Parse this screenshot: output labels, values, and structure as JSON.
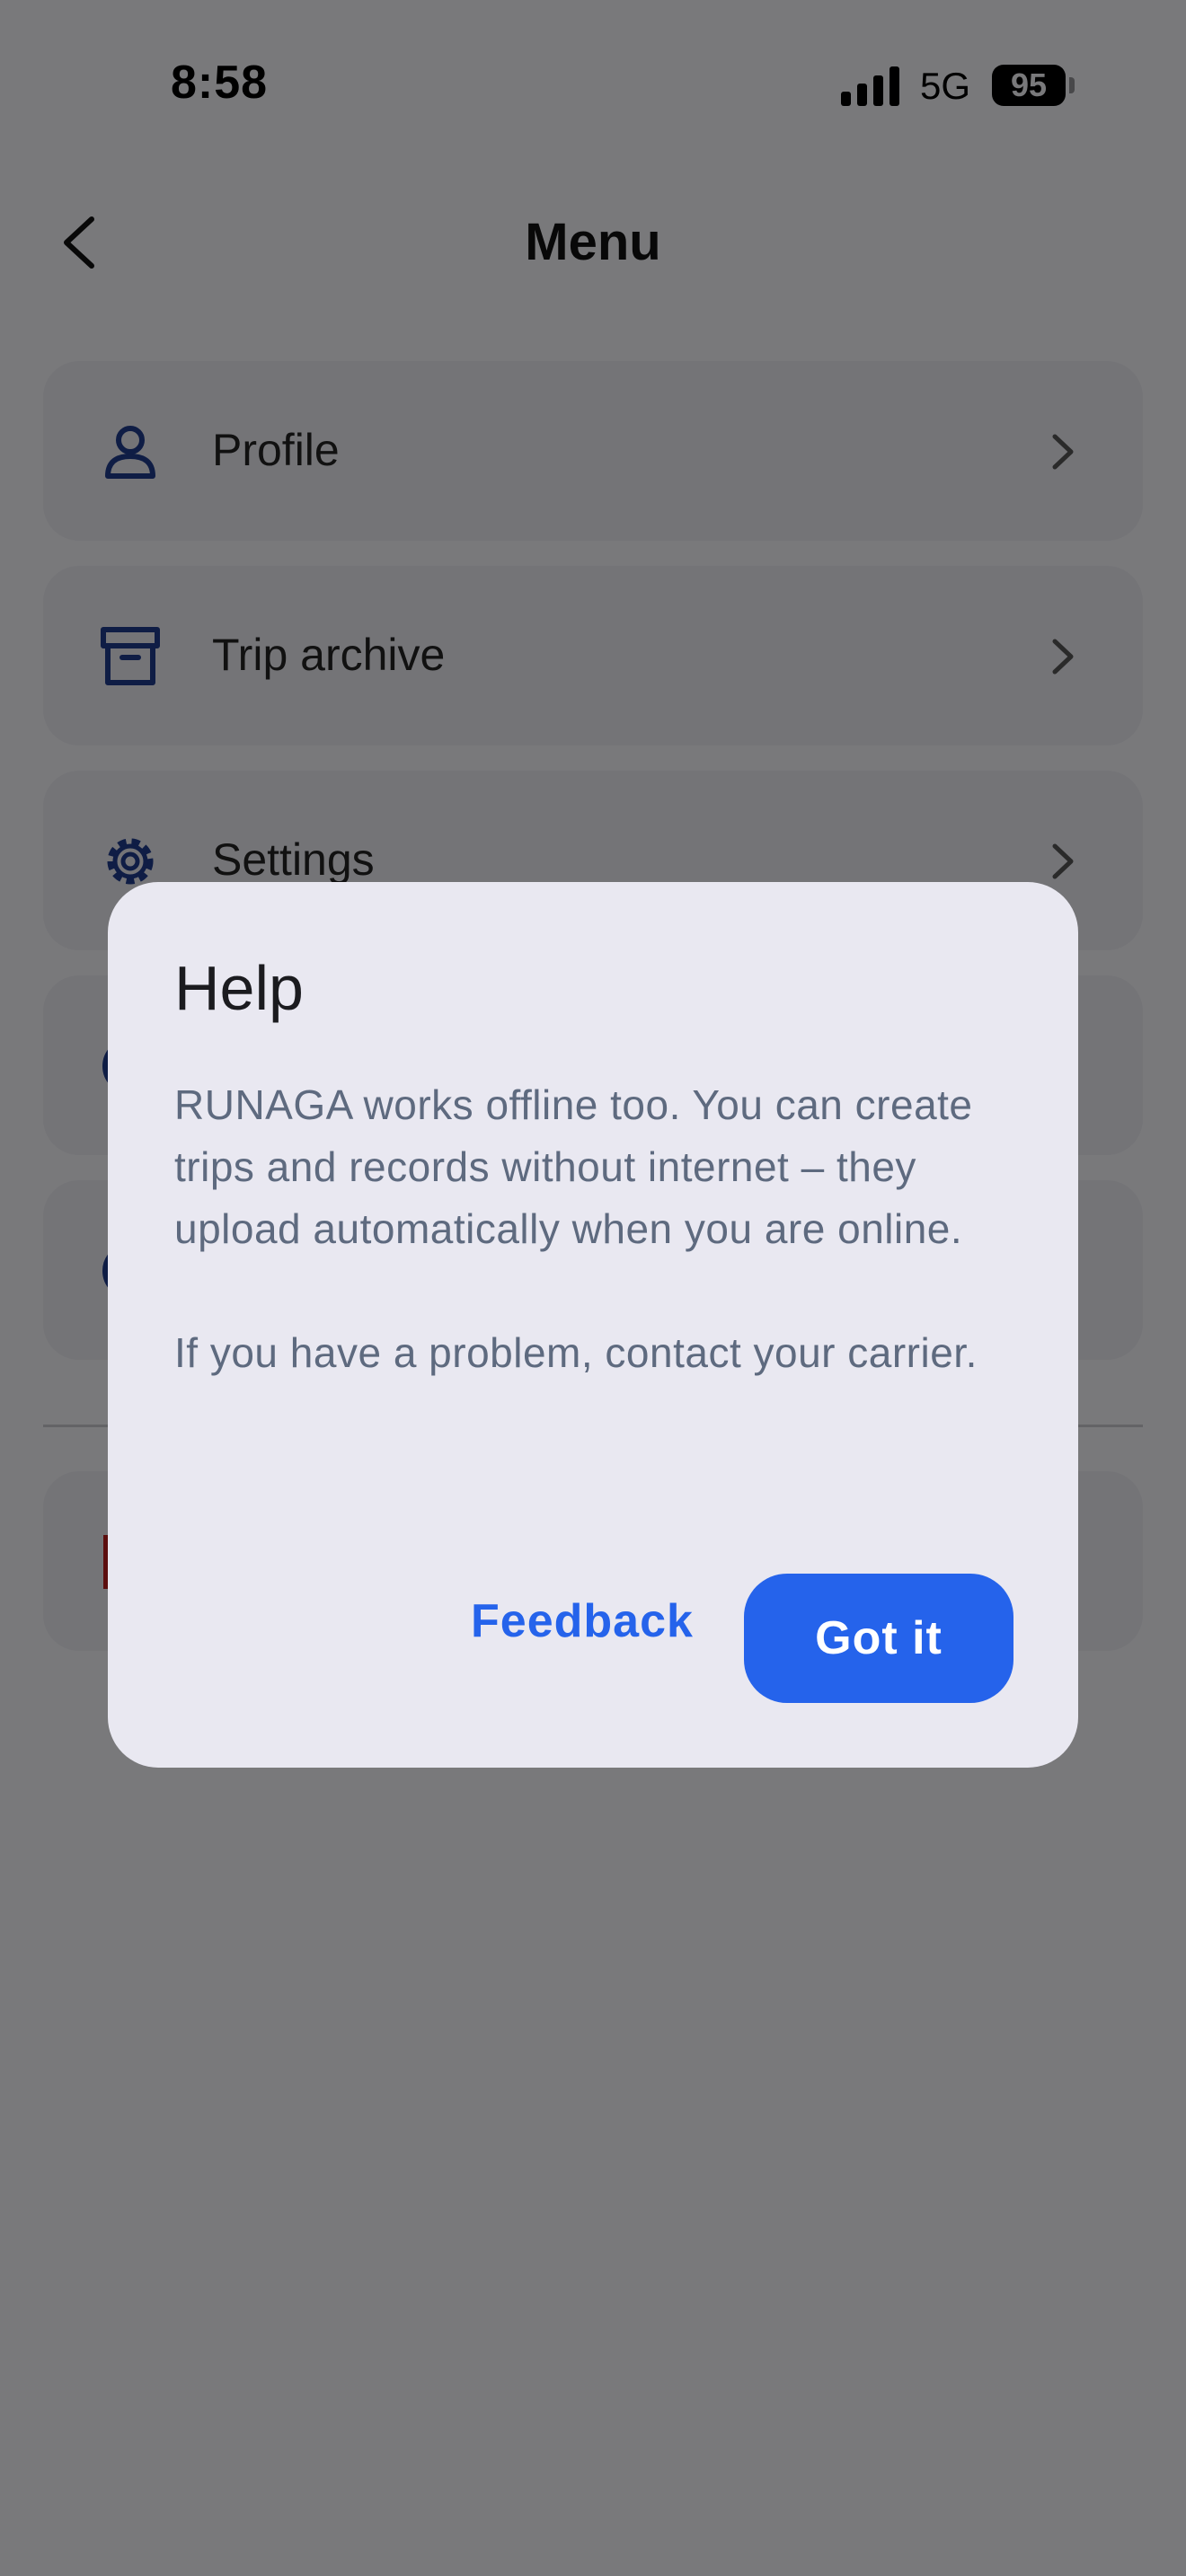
{
  "status_bar": {
    "time": "8:58",
    "network": "5G",
    "battery": "95"
  },
  "header": {
    "title": "Menu"
  },
  "menu": {
    "items": [
      {
        "label": "Profile",
        "icon": "person-icon"
      },
      {
        "label": "Trip archive",
        "icon": "archive-icon"
      },
      {
        "label": "Settings",
        "icon": "gear-icon"
      },
      {
        "label": "",
        "icon": "info-icon"
      },
      {
        "label": "",
        "icon": "help-icon"
      },
      {
        "label": "",
        "icon": "logout-icon"
      }
    ]
  },
  "dialog": {
    "title": "Help",
    "paragraph1": "RUNAGA works offline too. You can create trips and records without internet – they upload automatically when you are online.",
    "paragraph2": "If you have a problem, contact your carrier.",
    "feedback_label": "Feedback",
    "confirm_label": "Got it"
  },
  "colors": {
    "accent": "#2563eb",
    "icon_blue": "#1e3a8a",
    "danger": "#b91c1c",
    "dialog_bg": "#e9e8f1"
  }
}
